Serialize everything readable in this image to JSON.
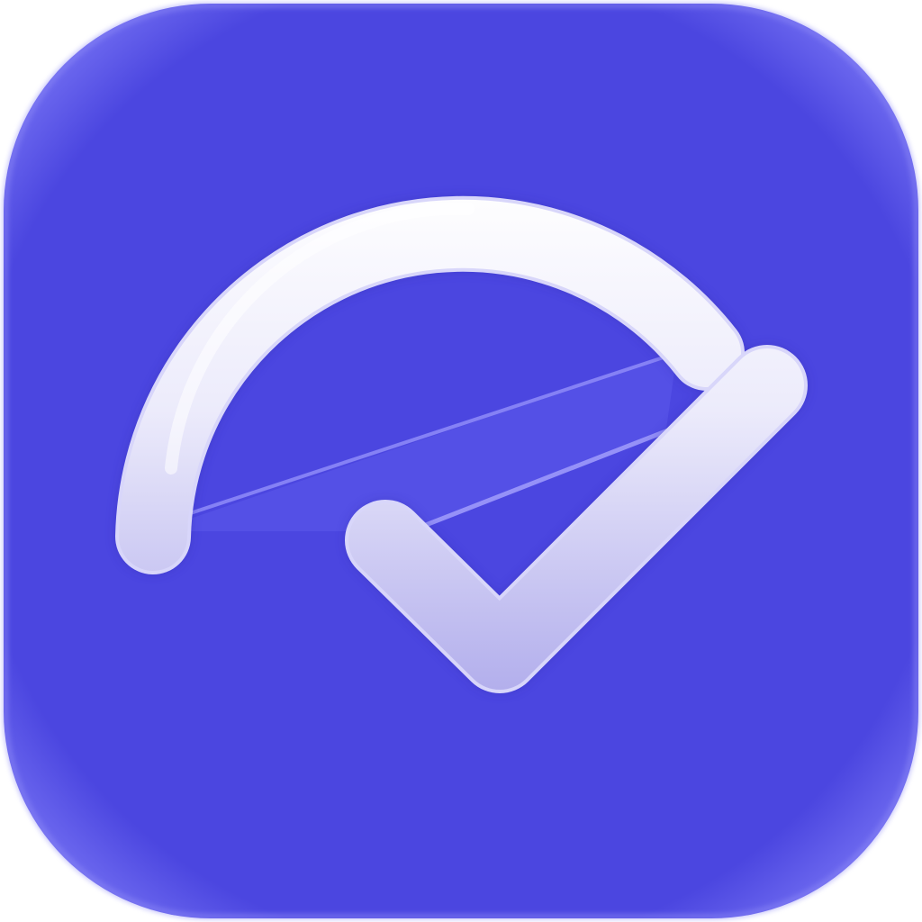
{
  "app_icon": {
    "icon": "checkmark-gauge-icon",
    "colors": {
      "background": "#4B46E0",
      "background_edge": "#6F6BF0",
      "glyph_light": "#FFFFFF",
      "glyph_shade": "#B2AEEC",
      "glyph_outline": "#D8D6FA"
    }
  }
}
